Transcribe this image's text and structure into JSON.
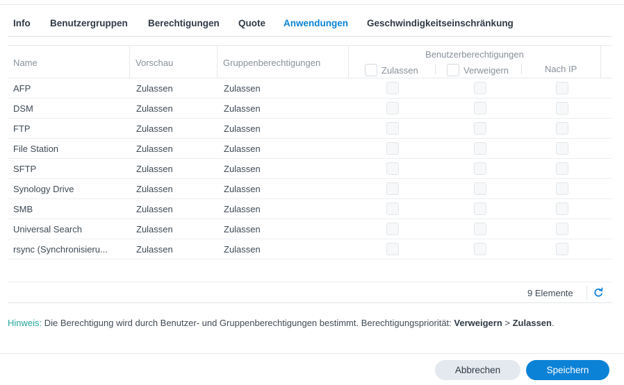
{
  "tabs": [
    {
      "label": "Info",
      "active": false
    },
    {
      "label": "Benutzergruppen",
      "active": false
    },
    {
      "label": "Berechtigungen",
      "active": false
    },
    {
      "label": "Quote",
      "active": false
    },
    {
      "label": "Anwendungen",
      "active": true
    },
    {
      "label": "Geschwindigkeitseinschränkung",
      "active": false
    }
  ],
  "table": {
    "headers": {
      "name": "Name",
      "preview": "Vorschau",
      "group_permissions": "Gruppenberechtigungen",
      "user_permissions": "Benutzerberechtigungen",
      "allow": "Zulassen",
      "deny": "Verweigern",
      "by_ip": "Nach IP"
    },
    "rows": [
      {
        "name": "AFP",
        "preview": "Zulassen",
        "group": "Zulassen"
      },
      {
        "name": "DSM",
        "preview": "Zulassen",
        "group": "Zulassen"
      },
      {
        "name": "FTP",
        "preview": "Zulassen",
        "group": "Zulassen"
      },
      {
        "name": "File Station",
        "preview": "Zulassen",
        "group": "Zulassen"
      },
      {
        "name": "SFTP",
        "preview": "Zulassen",
        "group": "Zulassen"
      },
      {
        "name": "Synology Drive",
        "preview": "Zulassen",
        "group": "Zulassen"
      },
      {
        "name": "SMB",
        "preview": "Zulassen",
        "group": "Zulassen"
      },
      {
        "name": "Universal Search",
        "preview": "Zulassen",
        "group": "Zulassen"
      },
      {
        "name": "rsync (Synchronisieru...",
        "preview": "Zulassen",
        "group": "Zulassen"
      }
    ]
  },
  "footer": {
    "item_count": "9 Elemente",
    "refresh_icon": "refresh-icon"
  },
  "note": {
    "label": "Hinweis:",
    "text": " Die Berechtigung wird durch Benutzer- und Gruppenberechtigungen bestimmt. Berechtigungspriorität: ",
    "strong1": "Verweigern",
    "sep": " > ",
    "strong2": "Zulassen",
    "end": "."
  },
  "buttons": {
    "cancel": "Abbrechen",
    "save": "Speichern"
  },
  "colors": {
    "accent": "#0b82d6",
    "note_label": "#26a69a"
  }
}
